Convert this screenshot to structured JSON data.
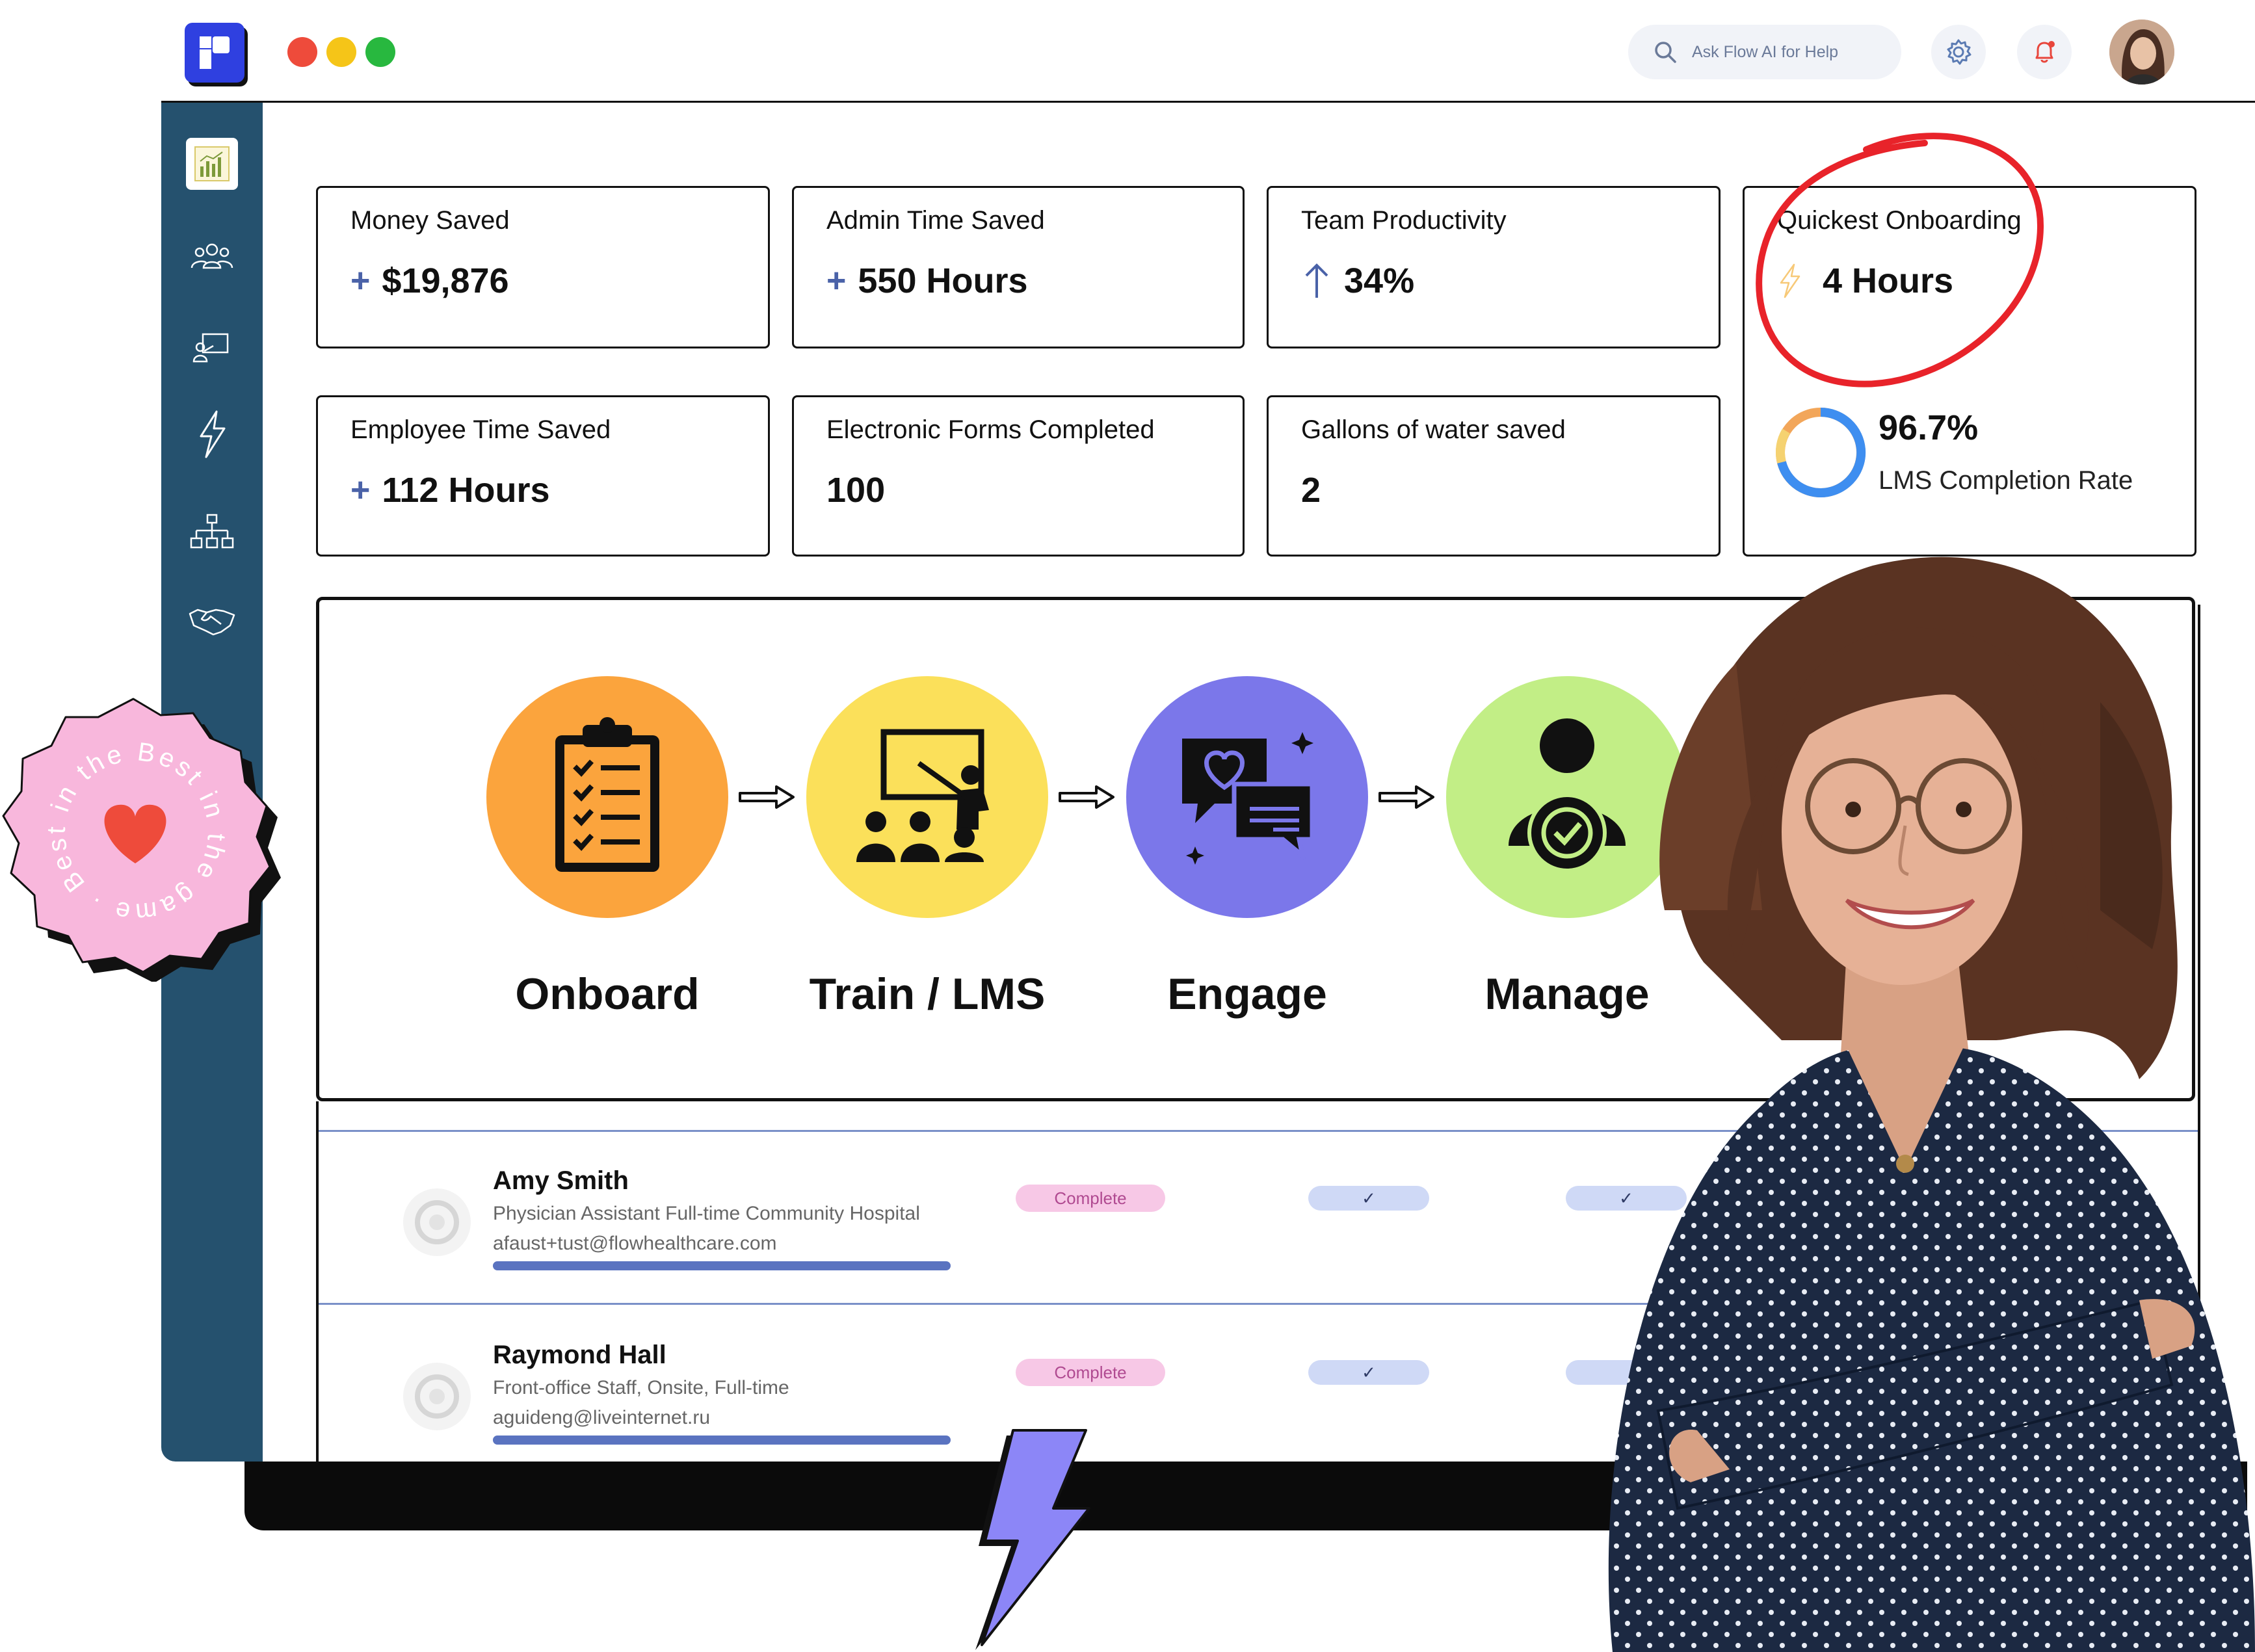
{
  "header": {
    "search_placeholder": "Ask Flow AI for Help",
    "window_dots": [
      "#ee4b3b",
      "#f5c518",
      "#28b83f"
    ]
  },
  "sidebar": {
    "items": [
      {
        "icon": "chart-icon",
        "active": true
      },
      {
        "icon": "team-icon",
        "active": false
      },
      {
        "icon": "training-icon",
        "active": false
      },
      {
        "icon": "lightning-icon",
        "active": false
      },
      {
        "icon": "org-chart-icon",
        "active": false
      },
      {
        "icon": "handshake-icon",
        "active": false
      }
    ]
  },
  "metrics": {
    "money_saved": {
      "label": "Money Saved",
      "value": "$19,876"
    },
    "admin_time": {
      "label": "Admin Time Saved",
      "value": "550 Hours"
    },
    "team_productivity": {
      "label": "Team Productivity",
      "value": "34%"
    },
    "quickest_onboarding": {
      "label": "Quickest Onboarding",
      "value": "4 Hours"
    },
    "employee_time": {
      "label": "Employee Time Saved",
      "value": "112 Hours"
    },
    "forms_completed": {
      "label": "Electronic Forms Completed",
      "value": "100"
    },
    "water_saved": {
      "label": "Gallons of water saved",
      "value": "2"
    },
    "lms_rate": {
      "value": "96.7%",
      "label": "LMS Completion Rate",
      "fraction": 0.967
    }
  },
  "process": {
    "steps": [
      {
        "label": "Onboard",
        "color": "#fba43d"
      },
      {
        "label": "Train / LMS",
        "color": "#fbe05a"
      },
      {
        "label": "Engage",
        "color": "#7b77ea"
      },
      {
        "label": "Manage",
        "color": "#c2ee86"
      }
    ]
  },
  "employees": [
    {
      "name": "Amy Smith",
      "role": "Physician Assistant Full-time Community Hospital",
      "email": "afaust+tust@flowhealthcare.com",
      "status": "Complete",
      "check1": "✓",
      "check2": "✓"
    },
    {
      "name": "Raymond Hall",
      "role": "Front-office Staff, Onsite, Full-time",
      "email": "aguideng@liveinternet.ru",
      "status": "Complete",
      "check1": "✓",
      "check2": ""
    }
  ],
  "badge": {
    "text": "Best in the game · Best in the game ·"
  },
  "colors": {
    "sidebar": "#25516e",
    "brand": "#2f40e0",
    "accent_red": "#e8232a",
    "bolt": "#8c86f7"
  }
}
